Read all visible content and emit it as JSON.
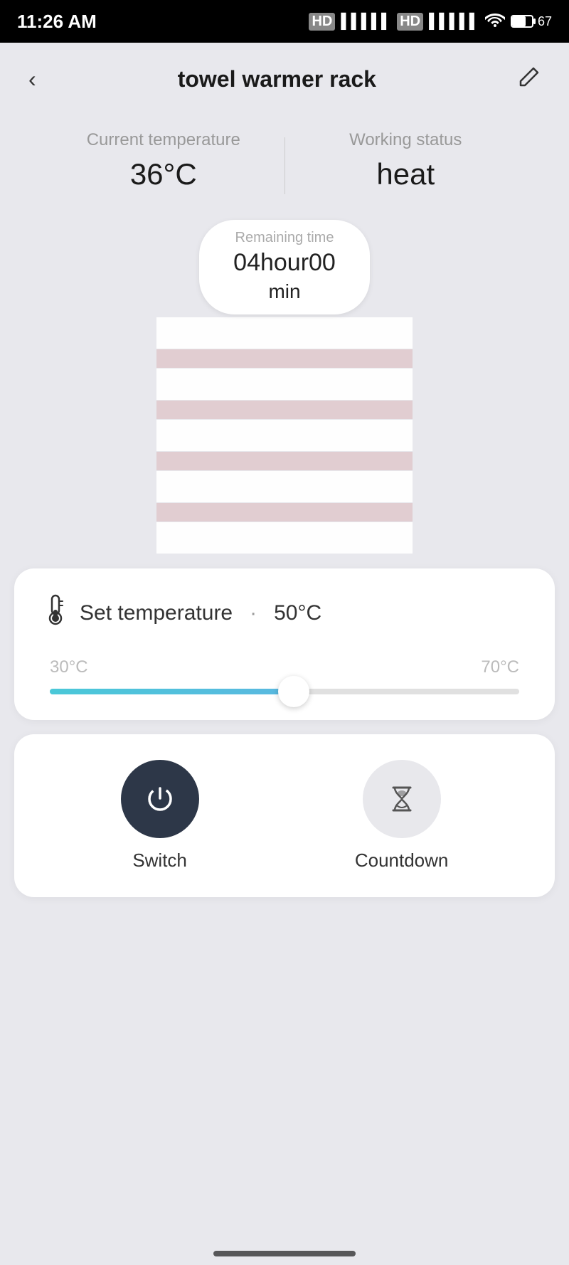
{
  "statusBar": {
    "time": "11:26 AM",
    "battery": "67"
  },
  "header": {
    "back_label": "‹",
    "title": "towel warmer rack",
    "edit_label": "✎"
  },
  "stats": {
    "current_temp_label": "Current temperature",
    "current_temp_value": "36°C",
    "working_status_label": "Working status",
    "working_status_value": "heat"
  },
  "remaining": {
    "label": "Remaining time",
    "value": "04hour00",
    "unit": "min"
  },
  "temperature": {
    "icon": "🌡",
    "set_label": "Set temperature",
    "dot": "·",
    "value": "50°C",
    "min": "30°C",
    "max": "70°C",
    "percent": 52
  },
  "controls": {
    "switch_label": "Switch",
    "countdown_label": "Countdown"
  }
}
